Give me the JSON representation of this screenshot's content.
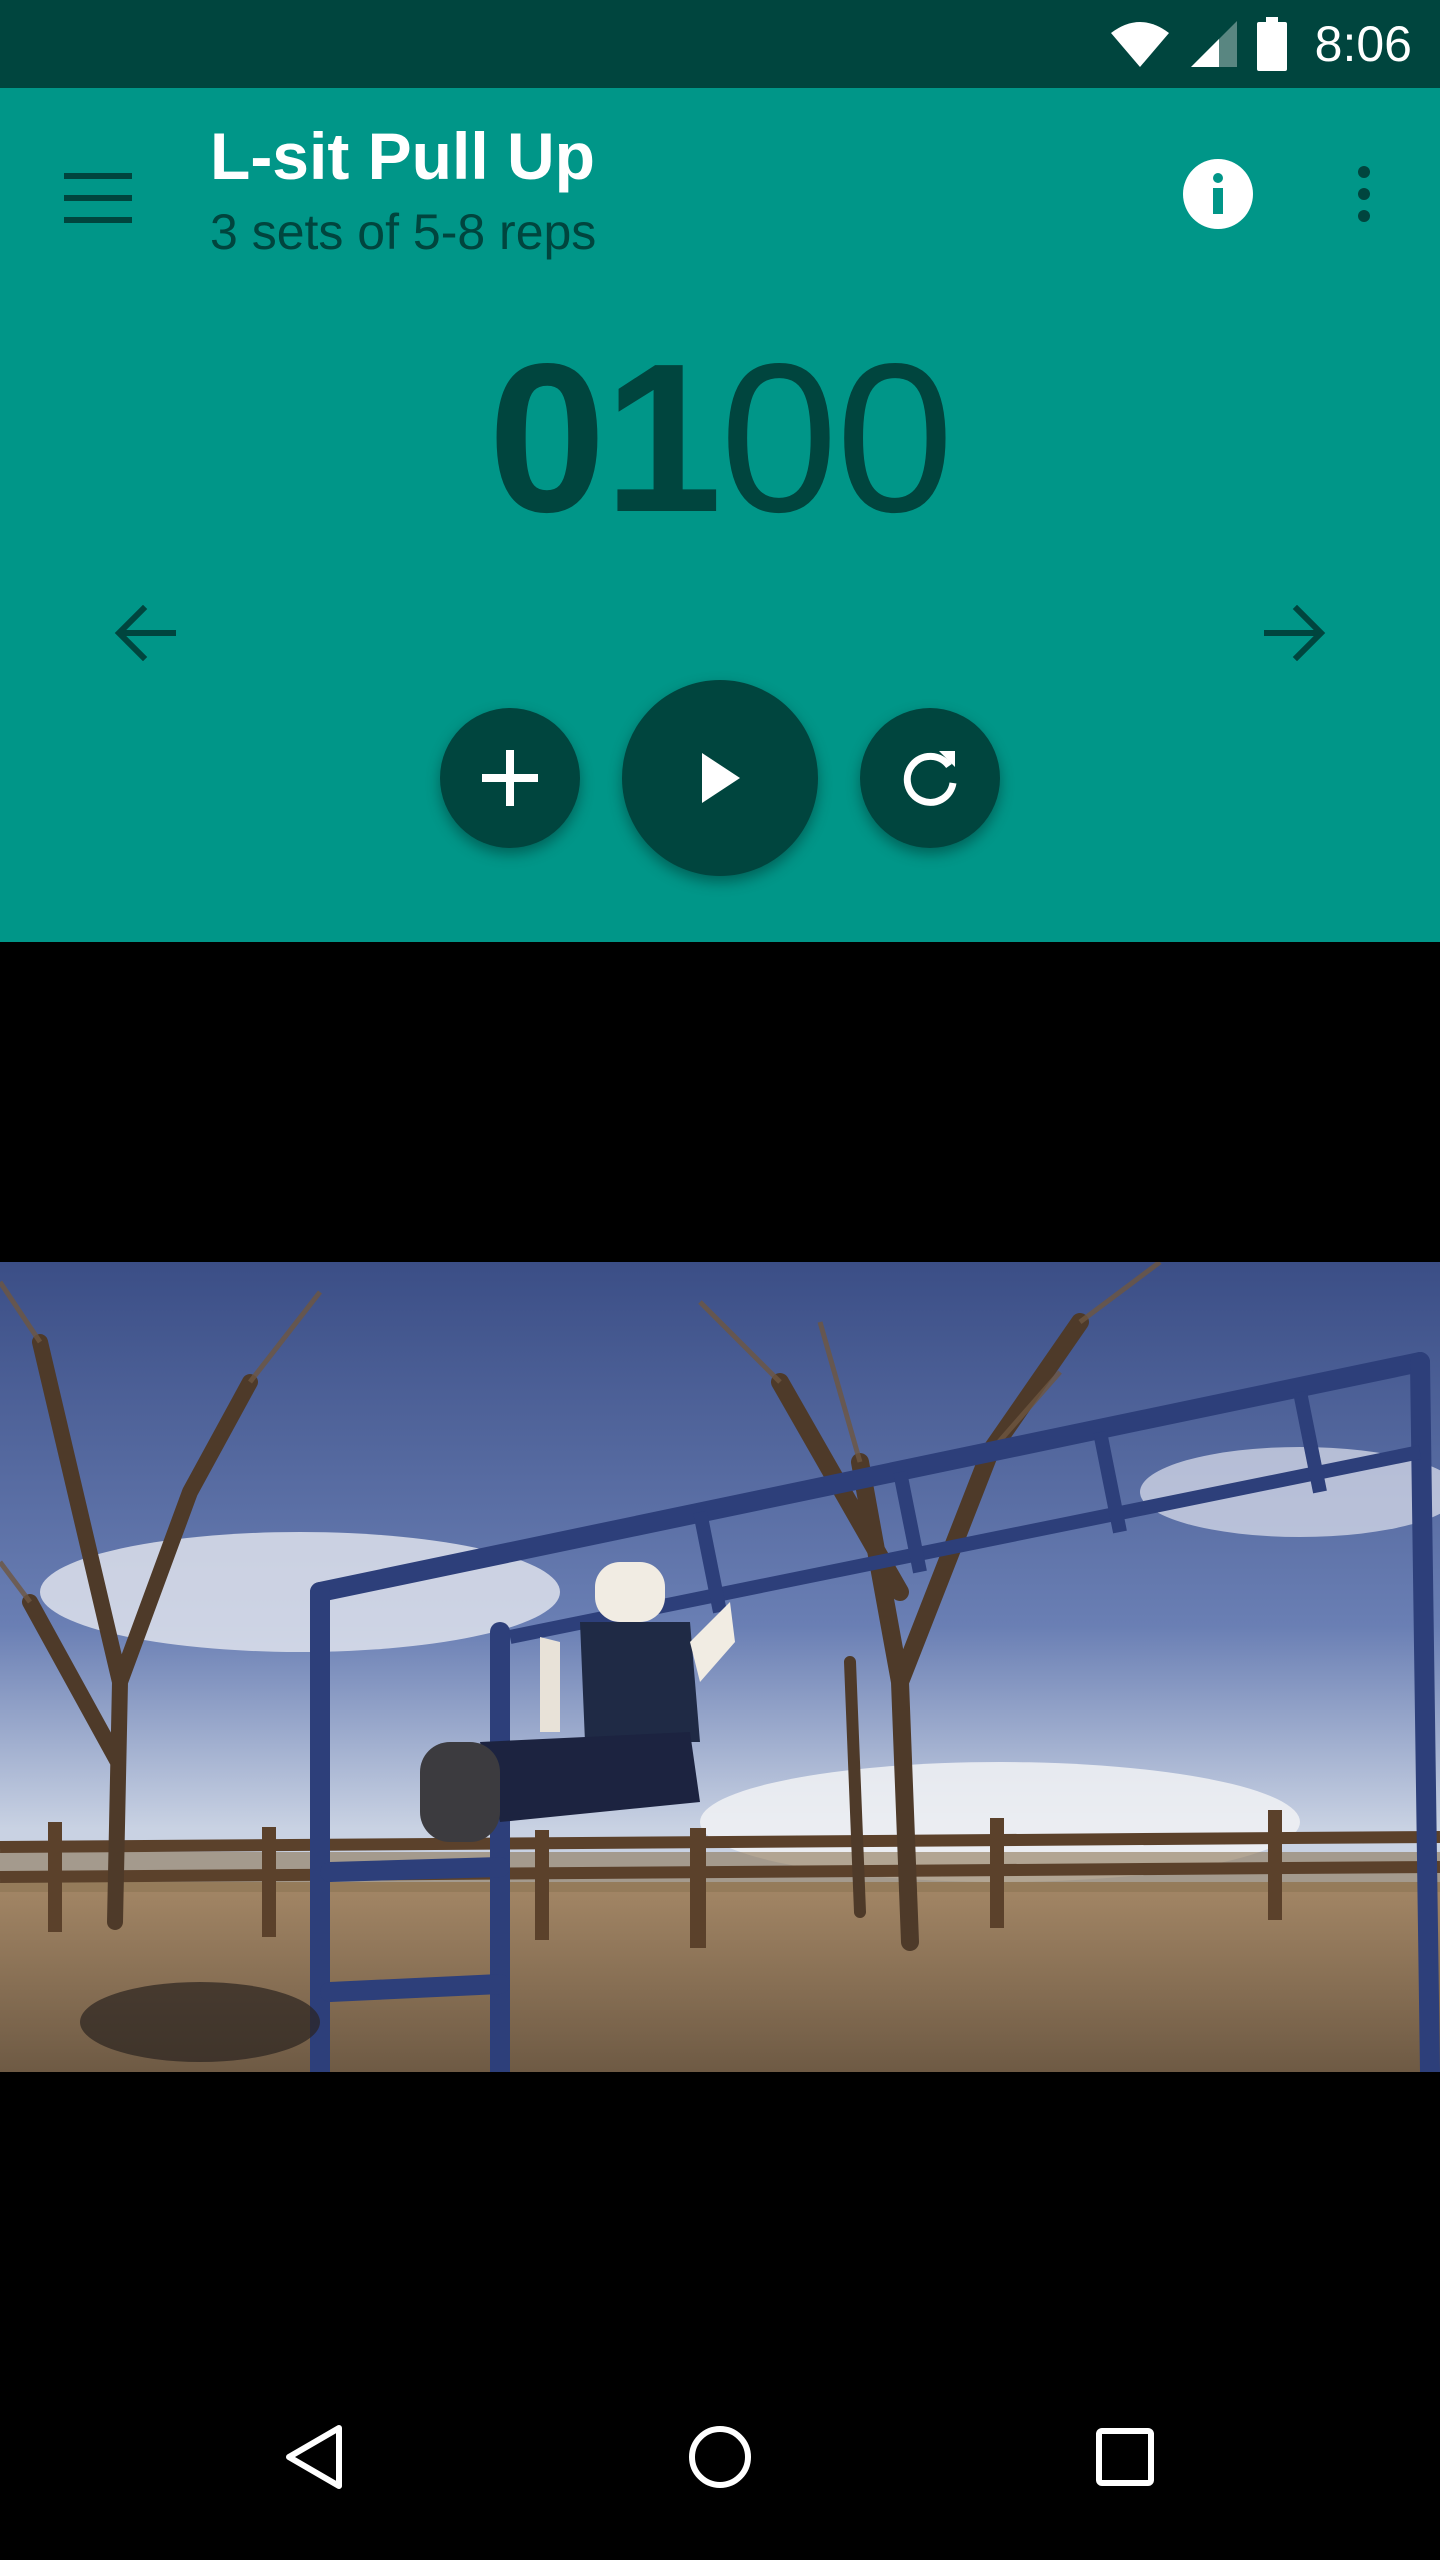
{
  "status_bar": {
    "time": "8:06",
    "icons": [
      "wifi-icon",
      "cell-signal-icon",
      "battery-icon"
    ]
  },
  "toolbar": {
    "menu_icon": "menu-icon",
    "title": "L-sit Pull Up",
    "subtitle": "3 sets of 5-8 reps",
    "info_icon": "info-icon",
    "more_icon": "more-vert-icon"
  },
  "timer": {
    "minutes": "01",
    "seconds": "00"
  },
  "controls": {
    "prev_icon": "arrow-left-icon",
    "next_icon": "arrow-right-icon",
    "add_icon": "plus-icon",
    "play_icon": "play-icon",
    "reset_icon": "refresh-icon"
  },
  "nav_bar": {
    "back_icon": "back-icon",
    "home_icon": "home-icon",
    "recents_icon": "recents-icon"
  },
  "colors": {
    "primary": "#009688",
    "primary_dark": "#00453e",
    "on_primary": "#ffffff",
    "background": "#000000"
  }
}
